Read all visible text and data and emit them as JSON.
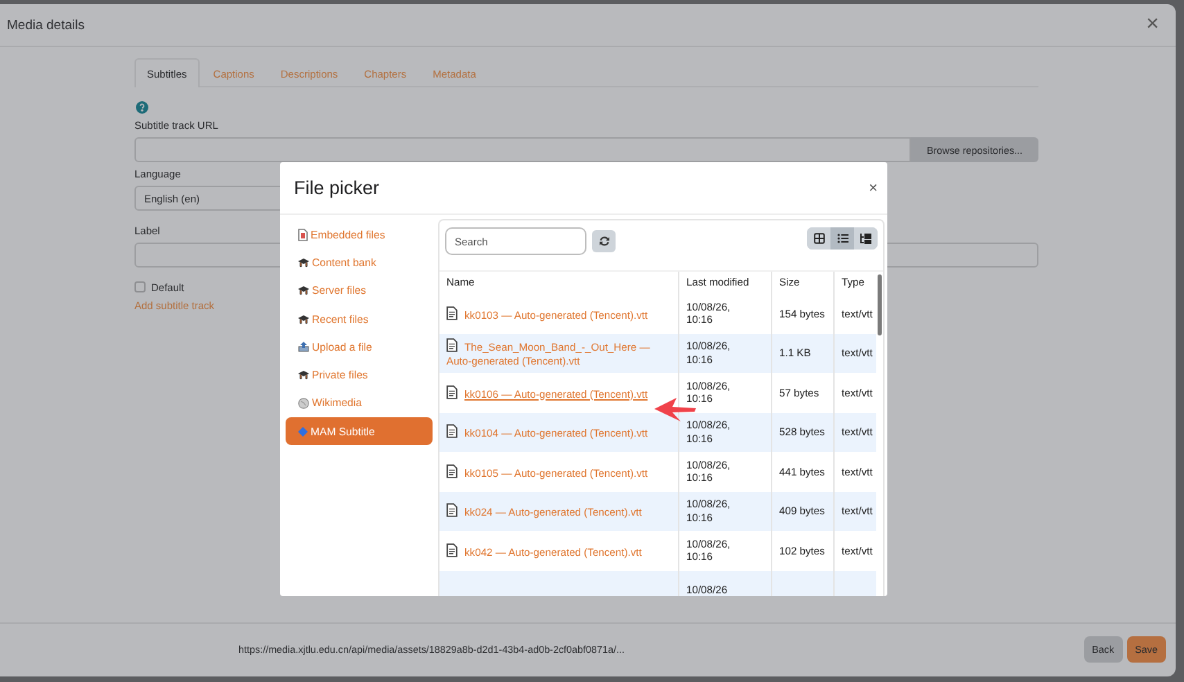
{
  "window": {
    "title": "Media details",
    "close": "×"
  },
  "tabs": [
    {
      "label": "Subtitles",
      "selected": true
    },
    {
      "label": "Captions",
      "selected": false
    },
    {
      "label": "Descriptions",
      "selected": false
    },
    {
      "label": "Chapters",
      "selected": false
    },
    {
      "label": "Metadata",
      "selected": false
    }
  ],
  "form": {
    "url_label": "Subtitle track URL",
    "browse_button": "Browse repositories...",
    "language_label": "Language",
    "language_value": "English (en)",
    "label_label": "Label",
    "default_label": "Default",
    "default_checked": false,
    "add_link": "Add subtitle track"
  },
  "footer": {
    "url": "https://media.xjtlu.edu.cn/api/media/assets/18829a8b-d2d1-43b4-ad0b-2cf0abf0871a/...",
    "buttons": [
      {
        "label": "Back",
        "kind": "secondary"
      },
      {
        "label": "Save",
        "kind": "primary"
      }
    ]
  },
  "file_picker": {
    "title": "File picker",
    "close": "×",
    "repositories": [
      {
        "label": "Embedded files",
        "kind": "embedded",
        "selected": false
      },
      {
        "label": "Content bank",
        "kind": "repo",
        "selected": false
      },
      {
        "label": "Server files",
        "kind": "repo",
        "selected": false
      },
      {
        "label": "Recent files",
        "kind": "repo",
        "selected": false
      },
      {
        "label": "Upload a file",
        "kind": "upload",
        "selected": false
      },
      {
        "label": "Private files",
        "kind": "repo",
        "selected": false
      },
      {
        "label": "Wikimedia",
        "kind": "globe",
        "selected": false
      },
      {
        "label": "MAM Subtitle",
        "kind": "mam",
        "selected": true
      }
    ],
    "search": {
      "placeholder": "Search"
    },
    "view_modes": [
      {
        "kind": "icons",
        "selected": false
      },
      {
        "kind": "list",
        "selected": true
      },
      {
        "kind": "tree",
        "selected": false
      }
    ],
    "table": {
      "columns": [
        "Name",
        "Last modified",
        "Size",
        "Type"
      ],
      "rows": [
        {
          "name": "kk0103 — Auto-generated (Tencent).vtt",
          "modified": "10/08/26, 10:16",
          "size": "154 bytes",
          "type": "text/vtt",
          "hovered": false
        },
        {
          "name": "The_Sean_Moon_Band_-_Out_Here — Auto-generated (Tencent).vtt",
          "modified": "10/08/26, 10:16",
          "size": "1.1 KB",
          "type": "text/vtt",
          "hovered": false
        },
        {
          "name": "kk0106 — Auto-generated (Tencent).vtt",
          "modified": "10/08/26, 10:16",
          "size": "57 bytes",
          "type": "text/vtt",
          "hovered": true
        },
        {
          "name": "kk0104 — Auto-generated (Tencent).vtt",
          "modified": "10/08/26, 10:16",
          "size": "528 bytes",
          "type": "text/vtt",
          "hovered": false
        },
        {
          "name": "kk0105 — Auto-generated (Tencent).vtt",
          "modified": "10/08/26, 10:16",
          "size": "441 bytes",
          "type": "text/vtt",
          "hovered": false
        },
        {
          "name": "kk024 — Auto-generated (Tencent).vtt",
          "modified": "10/08/26, 10:16",
          "size": "409 bytes",
          "type": "text/vtt",
          "hovered": false
        },
        {
          "name": "kk042 — Auto-generated (Tencent).vtt",
          "modified": "10/08/26, 10:16",
          "size": "102 bytes",
          "type": "text/vtt",
          "hovered": false
        },
        {
          "modified": "10/08/26"
        }
      ]
    }
  }
}
